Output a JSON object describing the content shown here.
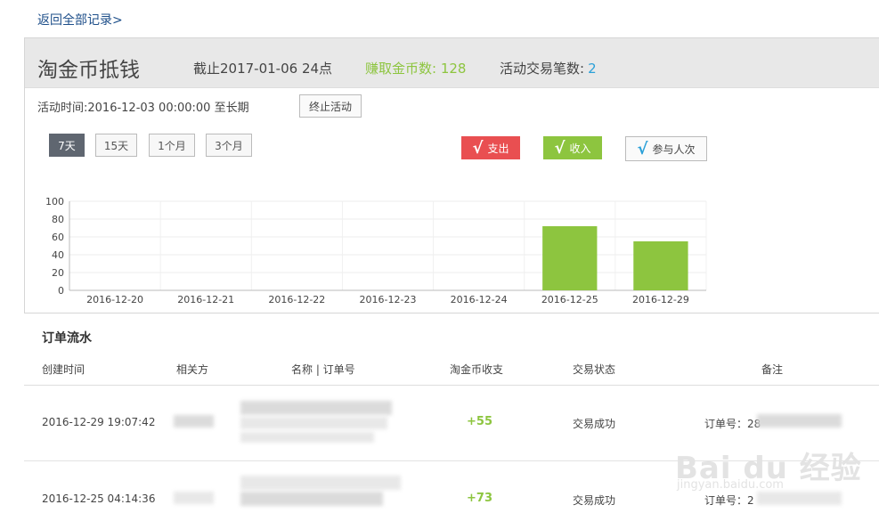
{
  "nav": {
    "back_label": "返回全部记录>"
  },
  "header": {
    "title": "淘金币抵钱",
    "deadline": "截止2017-01-06 24点",
    "earned_label": "赚取金币数: 128",
    "deals_label": "活动交易笔数:",
    "deals_count": "2"
  },
  "activity": {
    "time_label": "活动时间:2016-12-03 00:00:00 至长期",
    "stop_button": "终止活动"
  },
  "ranges": [
    {
      "label": "7天",
      "active": true
    },
    {
      "label": "15天",
      "active": false
    },
    {
      "label": "1个月",
      "active": false
    },
    {
      "label": "3个月",
      "active": false
    }
  ],
  "legend": {
    "check": "√",
    "out_label": "支出",
    "in_label": "收入",
    "participants_label": "参与人次"
  },
  "colors": {
    "income": "#8dc53f",
    "expense": "#e94f51",
    "accent": "#2aa0d8"
  },
  "chart_data": {
    "type": "bar",
    "categories": [
      "2016-12-20",
      "2016-12-21",
      "2016-12-22",
      "2016-12-23",
      "2016-12-24",
      "2016-12-25",
      "2016-12-29"
    ],
    "values": [
      0,
      0,
      0,
      0,
      0,
      72,
      55
    ],
    "ylim": [
      0,
      100
    ],
    "yticks": [
      0,
      20,
      40,
      60,
      80,
      100
    ],
    "grid": true
  },
  "orders": {
    "section_title": "订单流水",
    "columns": [
      "创建时间",
      "相关方",
      "名称 | 订单号",
      "淘金币收支",
      "交易状态",
      "备注"
    ],
    "rows": [
      {
        "time": "2016-12-29 19:07:42",
        "amount": "+55",
        "status": "交易成功",
        "remark": "订单号：28"
      },
      {
        "time": "2016-12-25 04:14:36",
        "amount": "+73",
        "status": "交易成功",
        "remark": "订单号：2"
      }
    ]
  },
  "watermark": {
    "text": "Bai du 经验",
    "sub": "jingyan.baidu.com"
  }
}
